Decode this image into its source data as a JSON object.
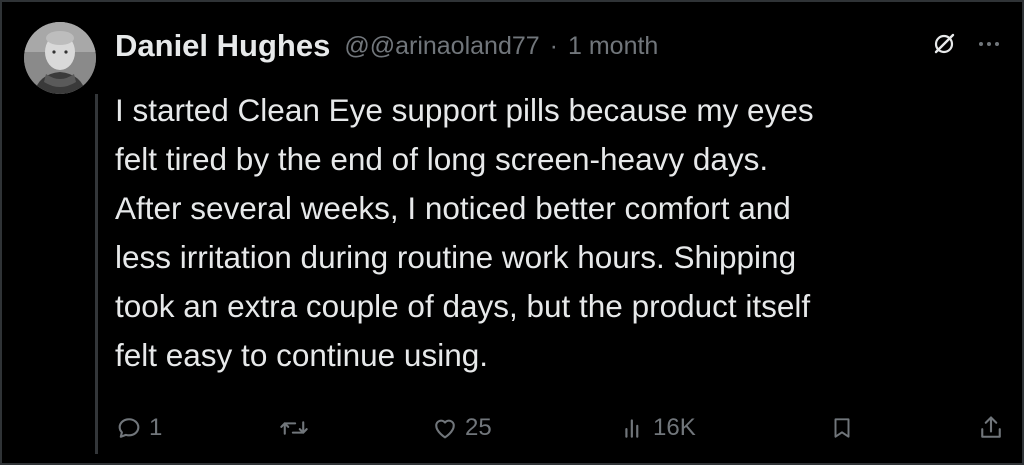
{
  "post": {
    "display_name": "Daniel Hughes",
    "handle": "@@arinaoland77",
    "separator": "·",
    "timestamp": "1 month",
    "text": "I started Clean Eye support pills because my eyes\nfelt tired by the end of long screen-heavy days.\nAfter several weeks, I noticed better comfort and\nless irritation during routine work hours. Shipping\ntook an extra couple of days, but the product itself\nfelt easy to continue using."
  },
  "actions": {
    "reply_count": "1",
    "retweet_count": "",
    "like_count": "25",
    "views_count": "16K"
  },
  "icons": {
    "avatar": "avatar-photo",
    "grok": "slashed-circle-icon",
    "more": "more-dots-icon",
    "reply": "reply-icon",
    "retweet": "retweet-icon",
    "like": "heart-icon",
    "views": "views-icon",
    "bookmark": "bookmark-icon",
    "share": "share-icon"
  },
  "colors": {
    "background": "#000000",
    "text_primary": "#e7e9ea",
    "text_secondary": "#71767b",
    "border": "#2f3336"
  }
}
